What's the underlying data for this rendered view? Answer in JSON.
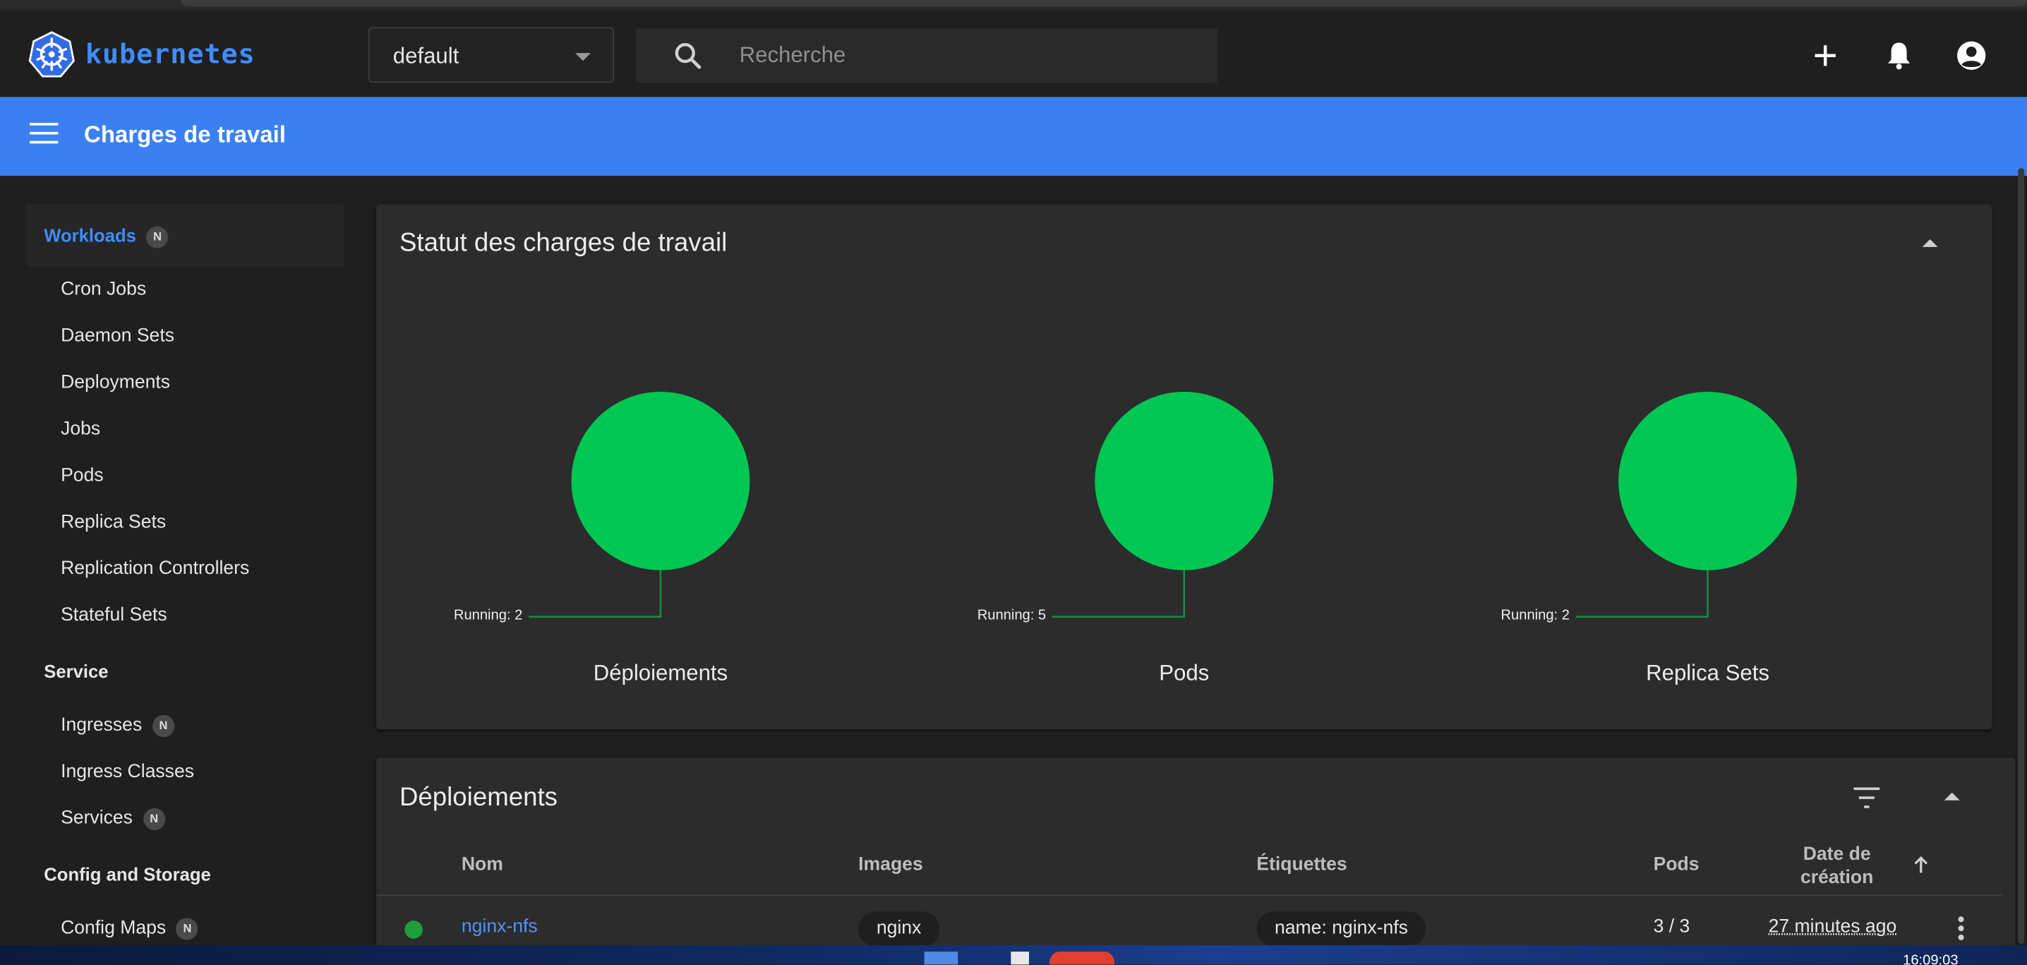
{
  "app": {
    "logo_text": "kubernetes"
  },
  "namespace": {
    "selected": "default"
  },
  "search": {
    "placeholder": "Recherche"
  },
  "header": {
    "title": "Charges de travail"
  },
  "sidebar": {
    "workloads": {
      "label": "Workloads",
      "badge": "N"
    },
    "workload_items": [
      {
        "label": "Cron Jobs"
      },
      {
        "label": "Daemon Sets"
      },
      {
        "label": "Deployments"
      },
      {
        "label": "Jobs"
      },
      {
        "label": "Pods"
      },
      {
        "label": "Replica Sets"
      },
      {
        "label": "Replication Controllers"
      },
      {
        "label": "Stateful Sets"
      }
    ],
    "service": {
      "label": "Service"
    },
    "service_items": [
      {
        "label": "Ingresses",
        "badge": "N"
      },
      {
        "label": "Ingress Classes"
      },
      {
        "label": "Services",
        "badge": "N"
      }
    ],
    "config": {
      "label": "Config and Storage"
    },
    "config_items": [
      {
        "label": "Config Maps",
        "badge": "N"
      }
    ]
  },
  "status_card": {
    "title": "Statut des charges de travail",
    "charts": [
      {
        "title": "Déploiements",
        "running_label": "Running: 2",
        "running": 2
      },
      {
        "title": "Pods",
        "running_label": "Running: 5",
        "running": 5
      },
      {
        "title": "Replica Sets",
        "running_label": "Running: 2",
        "running": 2
      }
    ],
    "running_color": "#00c752"
  },
  "deployments_card": {
    "title": "Déploiements",
    "columns": {
      "name": "Nom",
      "images": "Images",
      "labels": "Étiquettes",
      "pods": "Pods",
      "created": "Date de création"
    },
    "rows": [
      {
        "name": "nginx-nfs",
        "image": "nginx",
        "label": "name: nginx-nfs",
        "pods": "3 / 3",
        "created": "27 minutes ago",
        "status_color": "#1e9e3a"
      }
    ]
  },
  "taskbar": {
    "clock": "16:09:03"
  },
  "colors": {
    "accent": "#3a80f2",
    "link": "#4f93ff",
    "logo": "#3f8cff"
  }
}
